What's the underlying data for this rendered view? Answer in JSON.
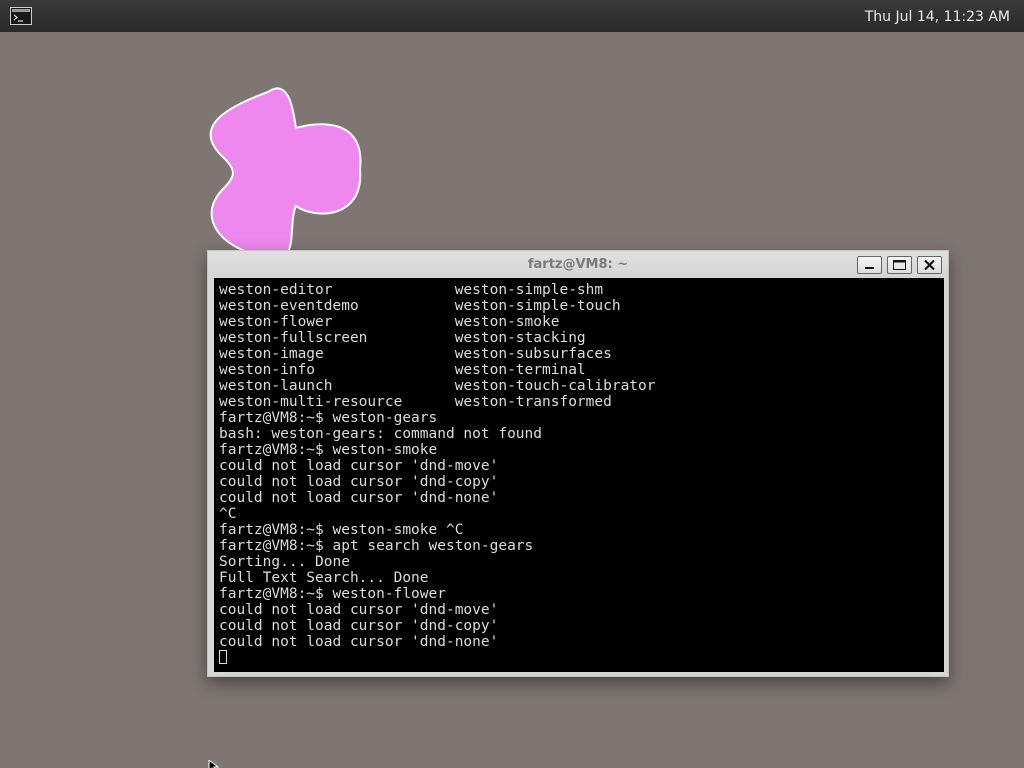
{
  "top_panel": {
    "launcher_icon": "terminal-launcher-icon",
    "clock": "Thu Jul 14, 11:23 AM"
  },
  "desktop": {
    "flower_color": "#ee88ee",
    "background_color": "#7f7674"
  },
  "terminal_window": {
    "title": "fartz@VM8: ~",
    "buttons": {
      "minimize_icon": "minimize-icon",
      "maximize_icon": "maximize-icon",
      "close_icon": "close-icon"
    },
    "lines": [
      "weston-editor              weston-simple-shm",
      "weston-eventdemo           weston-simple-touch",
      "weston-flower              weston-smoke",
      "weston-fullscreen          weston-stacking",
      "weston-image               weston-subsurfaces",
      "weston-info                weston-terminal",
      "weston-launch              weston-touch-calibrator",
      "weston-multi-resource      weston-transformed",
      "fartz@VM8:~$ weston-gears",
      "bash: weston-gears: command not found",
      "fartz@VM8:~$ weston-smoke",
      "could not load cursor 'dnd-move'",
      "could not load cursor 'dnd-copy'",
      "could not load cursor 'dnd-none'",
      "^C",
      "fartz@VM8:~$ weston-smoke ^C",
      "fartz@VM8:~$ apt search weston-gears",
      "Sorting... Done",
      "Full Text Search... Done",
      "fartz@VM8:~$ weston-flower",
      "could not load cursor 'dnd-move'",
      "could not load cursor 'dnd-copy'",
      "could not load cursor 'dnd-none'"
    ]
  }
}
